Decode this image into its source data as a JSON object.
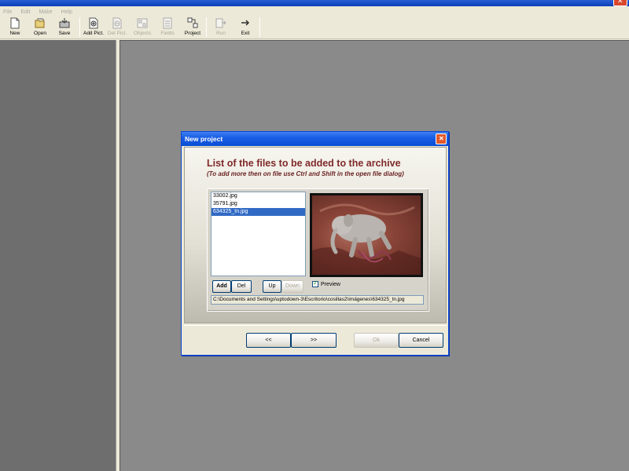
{
  "window": {
    "title": ""
  },
  "menu": [
    "File",
    "Edit",
    "Make",
    "Help"
  ],
  "toolbar": [
    {
      "label": "New",
      "icon": "new-document-icon",
      "enabled": true
    },
    {
      "label": "Open",
      "icon": "open-folder-icon",
      "enabled": true
    },
    {
      "label": "Save",
      "icon": "save-disk-icon",
      "enabled": true
    },
    {
      "label": "Add Pict.",
      "icon": "add-picture-icon",
      "enabled": true
    },
    {
      "label": "Del Pict.",
      "icon": "delete-picture-icon",
      "enabled": false
    },
    {
      "label": "Objects",
      "icon": "objects-icon",
      "enabled": false
    },
    {
      "label": "Fields",
      "icon": "fields-icon",
      "enabled": false
    },
    {
      "label": "Project",
      "icon": "project-icon",
      "enabled": true
    },
    {
      "label": "Run",
      "icon": "run-icon",
      "enabled": false
    },
    {
      "label": "Exit",
      "icon": "exit-icon",
      "enabled": true
    }
  ],
  "dialog": {
    "title": "New project",
    "heading": "List of the files to be added to the archive",
    "subheading": "(To add more then on file use Ctrl and Shift in the open file dialog)",
    "files": [
      "33002.jpg",
      "35791.jpg",
      "634325_tn.jpg"
    ],
    "selected_index": 2,
    "buttons": {
      "add": "Add",
      "del": "Del",
      "up": "Up",
      "down": "Down",
      "prev": "<<",
      "next": ">>",
      "ok": "Ok",
      "cancel": "Cancel"
    },
    "preview_label": "Preview",
    "preview_checked": true,
    "path": "C:\\Documents and Settings\\uptodown-3\\Escritorio\\cosillas2\\imágenes\\634325_tn.jpg"
  },
  "colors": {
    "heading": "#7f2a2a",
    "selection": "#316ac5",
    "titlebar": "#0a4ed5"
  }
}
